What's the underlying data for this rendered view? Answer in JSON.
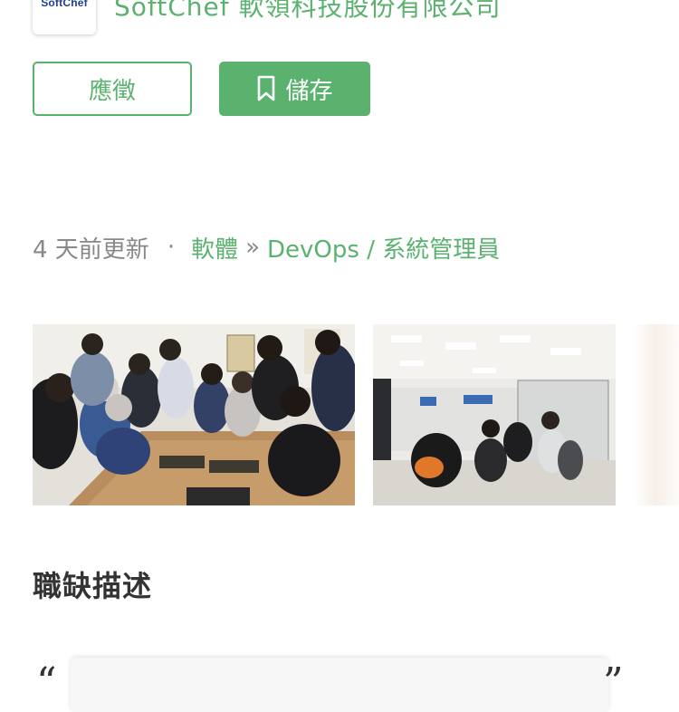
{
  "company": {
    "logo_text": "SoftChef",
    "name": "SoftChef 軟領科技股份有限公司"
  },
  "actions": {
    "apply_label": "應徵",
    "save_label": "儲存",
    "save_icon": "bookmark-icon"
  },
  "meta": {
    "updated": "4 天前更新",
    "dot": "·",
    "category": "軟體",
    "separator": "»",
    "subcategory": "DevOps / 系統管理員"
  },
  "gallery": {
    "photos": [
      "team-meeting-photo",
      "office-photo",
      "partial-photo"
    ]
  },
  "description": {
    "title": "職缺描述",
    "quote_open": "“",
    "quote_close": "”"
  },
  "colors": {
    "brand_green": "#5bb26f",
    "text_gray": "#888888",
    "title_dark": "#333333",
    "logo_blue": "#1e3f8f"
  }
}
